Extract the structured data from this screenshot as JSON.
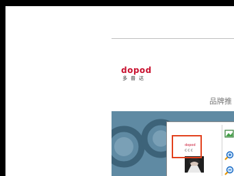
{
  "brand": {
    "logo_word": "dopod",
    "logo_cn": "多普达"
  },
  "heading": "品牌推",
  "thumbnail": {
    "logo_word": "dopod",
    "glyph": "ccc"
  },
  "toolbar": {
    "items": [
      "image-icon",
      "zoom-in-icon",
      "zoom-out-icon"
    ]
  },
  "colors": {
    "brand_red": "#c8102e",
    "highlight": "#e2401c",
    "banner": "#5f8aa3"
  }
}
